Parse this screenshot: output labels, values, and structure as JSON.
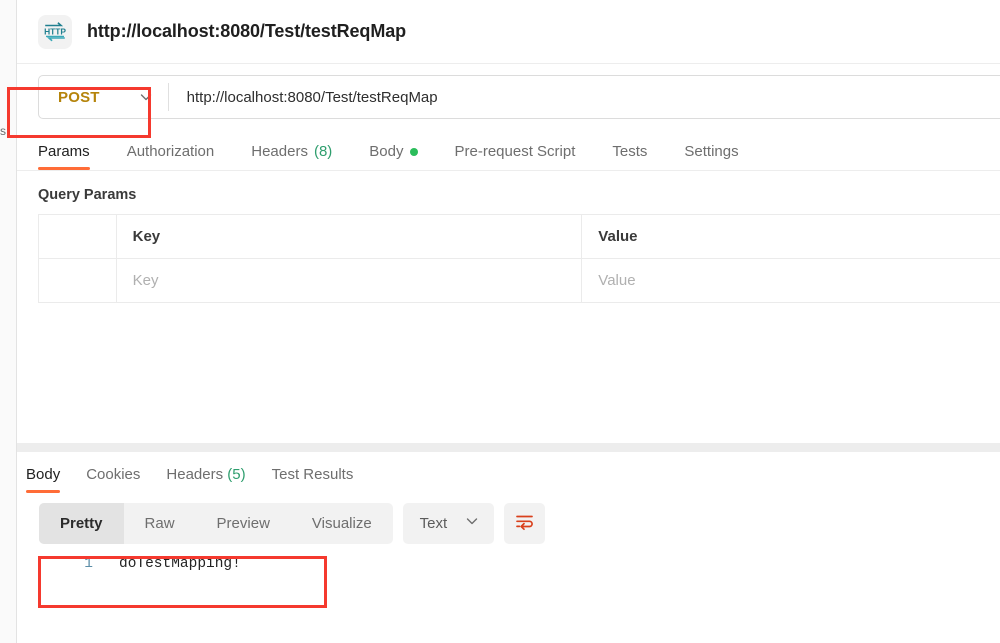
{
  "sidebar": {
    "cut_label": "s"
  },
  "request": {
    "icon": "http-protocol-icon",
    "title": "http://localhost:8080/Test/testReqMap",
    "method": "POST",
    "url": "http://localhost:8080/Test/testReqMap",
    "tabs": [
      {
        "label": "Params",
        "active": true
      },
      {
        "label": "Authorization",
        "active": false
      },
      {
        "label": "Headers",
        "count": "(8)",
        "active": false
      },
      {
        "label": "Body",
        "dot": true,
        "active": false
      },
      {
        "label": "Pre-request Script",
        "active": false
      },
      {
        "label": "Tests",
        "active": false
      },
      {
        "label": "Settings",
        "active": false
      }
    ],
    "query_params": {
      "section_title": "Query Params",
      "headers": [
        "",
        "Key",
        "Value"
      ],
      "rows": [
        {
          "key_placeholder": "Key",
          "value_placeholder": "Value"
        }
      ]
    }
  },
  "response": {
    "tabs": [
      {
        "label": "Body",
        "active": true
      },
      {
        "label": "Cookies",
        "active": false
      },
      {
        "label": "Headers",
        "count": "(5)",
        "active": false
      },
      {
        "label": "Test Results",
        "active": false
      }
    ],
    "view_modes": [
      {
        "label": "Pretty",
        "active": true
      },
      {
        "label": "Raw",
        "active": false
      },
      {
        "label": "Preview",
        "active": false
      },
      {
        "label": "Visualize",
        "active": false
      }
    ],
    "format": "Text",
    "wrap_icon": "wrap-lines-icon",
    "body_lines": [
      {
        "number": "1",
        "text": "doTestMapping!"
      }
    ]
  },
  "colors": {
    "accent": "#ff6c37",
    "method": "#b5840b",
    "annotation": "#f5392e",
    "count": "#2f9e6e",
    "dot": "#2bbd5b",
    "gutter": "#5c8ea8"
  }
}
